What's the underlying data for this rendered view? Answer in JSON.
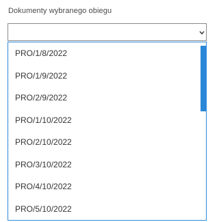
{
  "field": {
    "label": "Dokumenty wybranego obiegu",
    "selected_value": ""
  },
  "dropdown": {
    "options": [
      "PRO/1/8/2022",
      "PRO/1/9/2022",
      "PRO/2/9/2022",
      "PRO/1/10/2022",
      "PRO/2/10/2022",
      "PRO/3/10/2022",
      "PRO/4/10/2022",
      "PRO/5/10/2022"
    ]
  },
  "colors": {
    "accent": "#2b88d8",
    "border": "#8a8a8a",
    "text": "#333333"
  },
  "icons": {
    "chevron": "chevron-down-icon"
  }
}
